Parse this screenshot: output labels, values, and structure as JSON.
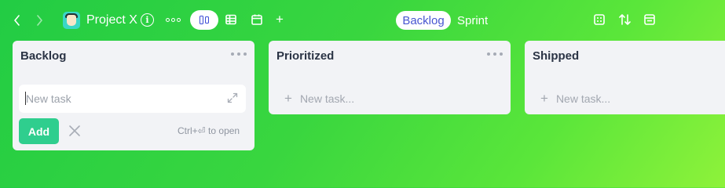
{
  "topbar": {
    "back_icon": "chevron-left-icon",
    "forward_icon": "chevron-right-icon",
    "project_title": "Project X",
    "info_glyph": "i",
    "views": {
      "board_icon": "board-view-icon",
      "table_icon": "table-view-icon",
      "calendar_icon": "calendar-view-icon",
      "add_glyph": "+"
    },
    "segments": [
      {
        "label": "Backlog",
        "active": true
      },
      {
        "label": "Sprint",
        "active": false
      }
    ],
    "right_icons": [
      "layout-icon",
      "sort-icon",
      "archive-icon"
    ]
  },
  "columns": [
    {
      "title": "Backlog",
      "editor": {
        "value": "",
        "placeholder": "New task",
        "add_label": "Add",
        "hint": "Ctrl+⏎ to open"
      }
    },
    {
      "title": "Prioritized",
      "add_placeholder": "New task..."
    },
    {
      "title": "Shipped",
      "add_placeholder": "New task..."
    }
  ],
  "colors": {
    "background_start": "#22cc44",
    "background_end": "#8ef23a",
    "accent": "#4856d1",
    "add_button": "#2fce8e",
    "column": "#f2f3f6"
  }
}
